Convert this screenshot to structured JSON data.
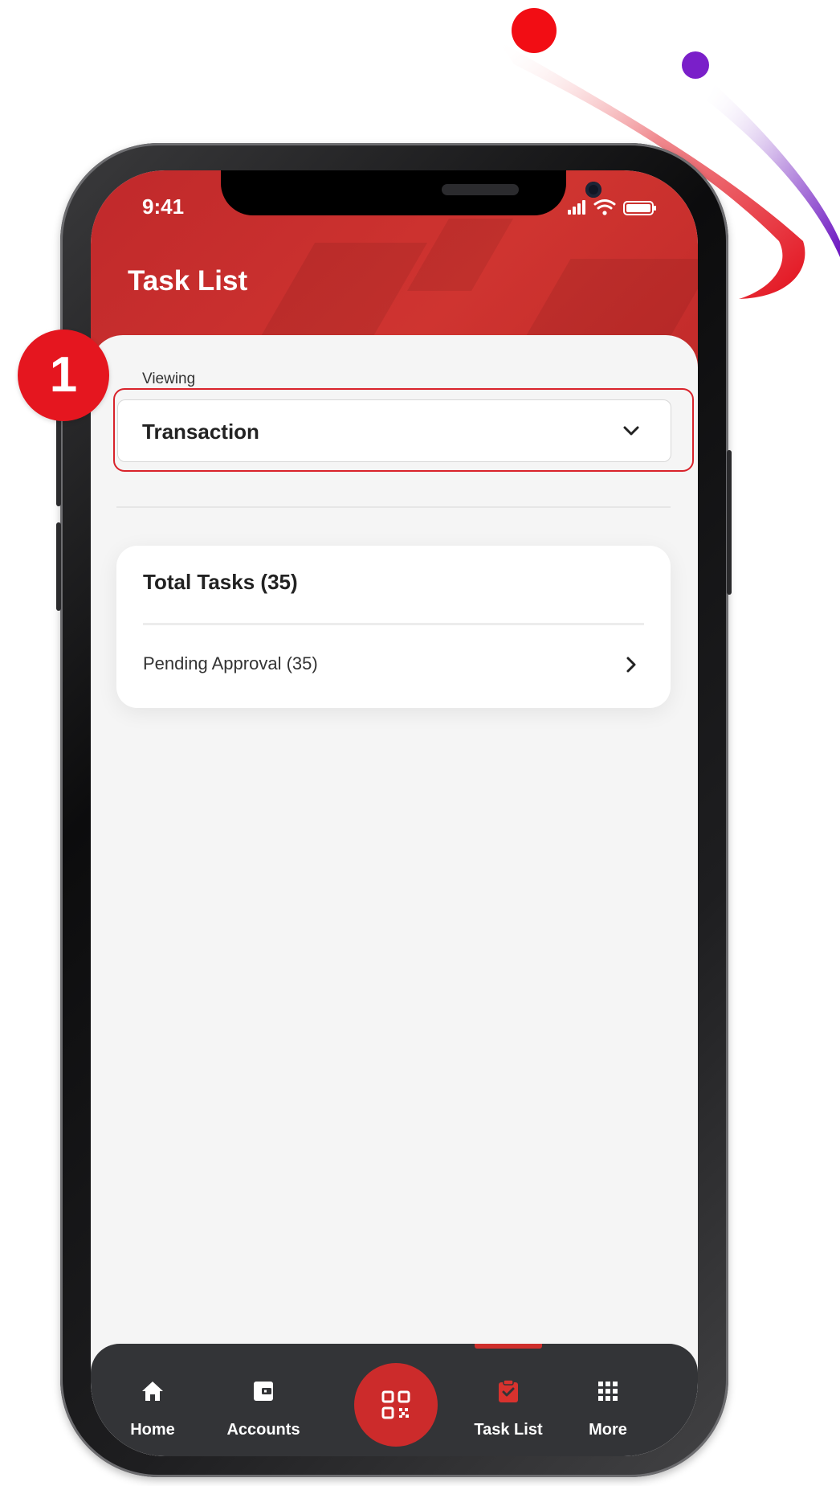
{
  "status_bar": {
    "time": "9:41"
  },
  "header": {
    "title": "Task List"
  },
  "filter": {
    "label": "Viewing",
    "selected": "Transaction"
  },
  "tasks_card": {
    "title": "Total Tasks (35)",
    "rows": [
      {
        "label": "Pending Approval (35)"
      }
    ]
  },
  "nav": {
    "items": [
      {
        "label": "Home",
        "icon": "home-icon"
      },
      {
        "label": "Accounts",
        "icon": "wallet-icon"
      },
      {
        "label": "Task List",
        "icon": "clipboard-check-icon",
        "active": true
      },
      {
        "label": "More",
        "icon": "grid-icon"
      }
    ],
    "center_button_icon": "qr-code-icon"
  },
  "step_badge": "1",
  "colors": {
    "brand_red": "#cc2b2b",
    "badge_red": "#e5161f",
    "nav_bg": "#333437",
    "deco_purple": "#7a1fc9"
  }
}
